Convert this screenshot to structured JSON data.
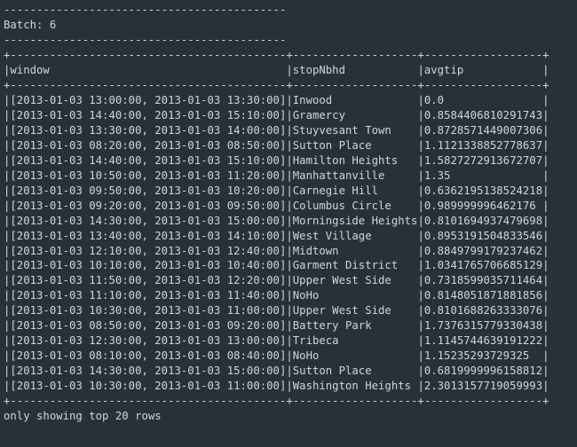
{
  "batch_label": "Batch: 6",
  "columns": [
    "window",
    "stopNbhd",
    "avgtip"
  ],
  "rows": [
    {
      "window": "[2013-01-03 13:00:00, 2013-01-03 13:30:00]",
      "stopNbhd": "Inwood",
      "avgtip": "0.0"
    },
    {
      "window": "[2013-01-03 14:40:00, 2013-01-03 15:10:00]",
      "stopNbhd": "Gramercy",
      "avgtip": "0.8584406810291743"
    },
    {
      "window": "[2013-01-03 13:30:00, 2013-01-03 14:00:00]",
      "stopNbhd": "Stuyvesant Town",
      "avgtip": "0.8728571449007306"
    },
    {
      "window": "[2013-01-03 08:20:00, 2013-01-03 08:50:00]",
      "stopNbhd": "Sutton Place",
      "avgtip": "1.1121338852778637"
    },
    {
      "window": "[2013-01-03 14:40:00, 2013-01-03 15:10:00]",
      "stopNbhd": "Hamilton Heights",
      "avgtip": "1.5827272913672707"
    },
    {
      "window": "[2013-01-03 10:50:00, 2013-01-03 11:20:00]",
      "stopNbhd": "Manhattanville",
      "avgtip": "1.35"
    },
    {
      "window": "[2013-01-03 09:50:00, 2013-01-03 10:20:00]",
      "stopNbhd": "Carnegie Hill",
      "avgtip": "0.6362195138524218"
    },
    {
      "window": "[2013-01-03 09:20:00, 2013-01-03 09:50:00]",
      "stopNbhd": "Columbus Circle",
      "avgtip": "0.989999996462176"
    },
    {
      "window": "[2013-01-03 14:30:00, 2013-01-03 15:00:00]",
      "stopNbhd": "Morningside Heights",
      "avgtip": "0.8101694937479698"
    },
    {
      "window": "[2013-01-03 13:40:00, 2013-01-03 14:10:00]",
      "stopNbhd": "West Village",
      "avgtip": "0.8953191504833546"
    },
    {
      "window": "[2013-01-03 12:10:00, 2013-01-03 12:40:00]",
      "stopNbhd": "Midtown",
      "avgtip": "0.8849799179237462"
    },
    {
      "window": "[2013-01-03 10:10:00, 2013-01-03 10:40:00]",
      "stopNbhd": "Garment District",
      "avgtip": "1.0341765706685129"
    },
    {
      "window": "[2013-01-03 11:50:00, 2013-01-03 12:20:00]",
      "stopNbhd": "Upper West Side",
      "avgtip": "0.7318599035711464"
    },
    {
      "window": "[2013-01-03 11:10:00, 2013-01-03 11:40:00]",
      "stopNbhd": "NoHo",
      "avgtip": "0.8148051871881856"
    },
    {
      "window": "[2013-01-03 10:30:00, 2013-01-03 11:00:00]",
      "stopNbhd": "Upper West Side",
      "avgtip": "0.8101688263333076"
    },
    {
      "window": "[2013-01-03 08:50:00, 2013-01-03 09:20:00]",
      "stopNbhd": "Battery Park",
      "avgtip": "1.7376315779330438"
    },
    {
      "window": "[2013-01-03 12:30:00, 2013-01-03 13:00:00]",
      "stopNbhd": "Tribeca",
      "avgtip": "1.1145744639191222"
    },
    {
      "window": "[2013-01-03 08:10:00, 2013-01-03 08:40:00]",
      "stopNbhd": "NoHo",
      "avgtip": "1.15235293729325"
    },
    {
      "window": "[2013-01-03 14:30:00, 2013-01-03 15:00:00]",
      "stopNbhd": "Sutton Place",
      "avgtip": "0.6819999996158812"
    },
    {
      "window": "[2013-01-03 10:30:00, 2013-01-03 11:00:00]",
      "stopNbhd": "Washington Heights",
      "avgtip": "2.3013157719059993"
    }
  ],
  "footer": "only showing top 20 rows",
  "col_widths": {
    "window": 42,
    "stopNbhd": 19,
    "avgtip": 18
  }
}
